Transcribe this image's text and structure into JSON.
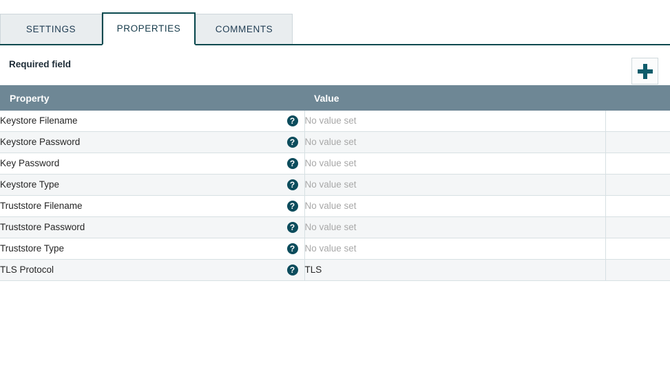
{
  "tabs": [
    {
      "label": "SETTINGS",
      "active": false,
      "name": "tab-settings"
    },
    {
      "label": "PROPERTIES",
      "active": true,
      "name": "tab-properties"
    },
    {
      "label": "COMMENTS",
      "active": false,
      "name": "tab-comments"
    }
  ],
  "subheader": {
    "required_label": "Required field",
    "add_button_icon": "plus-icon"
  },
  "table": {
    "columns": [
      {
        "key": "property",
        "label": "Property"
      },
      {
        "key": "value",
        "label": "Value"
      },
      {
        "key": "actions",
        "label": ""
      }
    ],
    "help_icon_glyph": "?",
    "empty_value_text": "No value set",
    "rows": [
      {
        "property": "Keystore Filename",
        "value": "No value set",
        "empty": true,
        "help": "?"
      },
      {
        "property": "Keystore Password",
        "value": "No value set",
        "empty": true,
        "help": "?"
      },
      {
        "property": "Key Password",
        "value": "No value set",
        "empty": true,
        "help": "?"
      },
      {
        "property": "Keystore Type",
        "value": "No value set",
        "empty": true,
        "help": "?"
      },
      {
        "property": "Truststore Filename",
        "value": "No value set",
        "empty": true,
        "help": "?"
      },
      {
        "property": "Truststore Password",
        "value": "No value set",
        "empty": true,
        "help": "?"
      },
      {
        "property": "Truststore Type",
        "value": "No value set",
        "empty": true,
        "help": "?"
      },
      {
        "property": "TLS Protocol",
        "value": "TLS",
        "empty": false,
        "help": "?"
      }
    ]
  },
  "colors": {
    "accent": "#0b4a4f",
    "table_header_bg": "#6e8795",
    "row_stripe": "#f4f6f7",
    "tab_inactive_bg": "#e9edef",
    "help_icon_bg": "#0c4c5c",
    "muted_text": "#a8a8a8"
  }
}
